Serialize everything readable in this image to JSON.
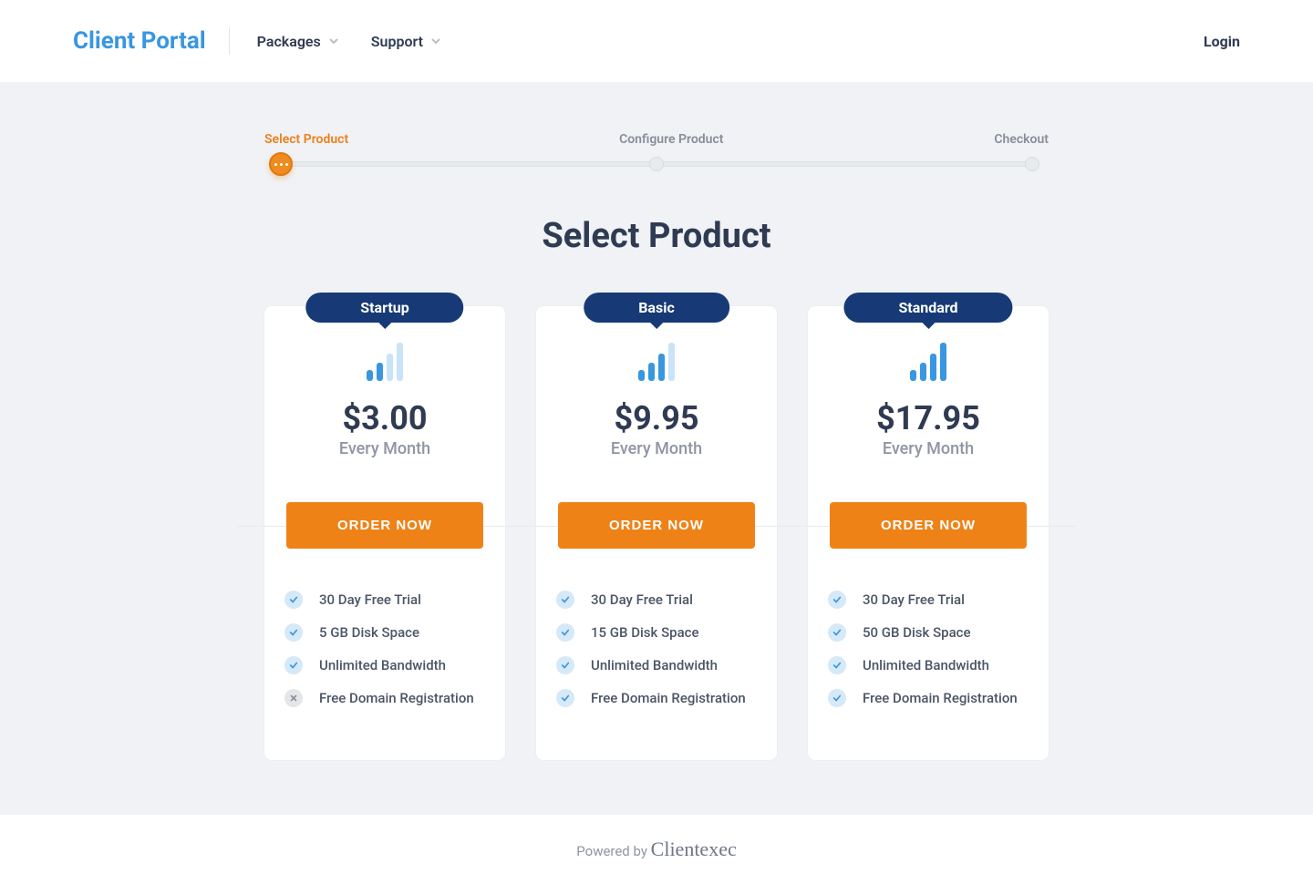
{
  "header": {
    "logo": "Client Portal",
    "nav": [
      {
        "label": "Packages"
      },
      {
        "label": "Support"
      }
    ],
    "login": "Login"
  },
  "progress": {
    "steps": [
      {
        "label": "Select Product",
        "active": true
      },
      {
        "label": "Configure Product",
        "active": false
      },
      {
        "label": "Checkout",
        "active": false
      }
    ]
  },
  "page_title": "Select Product",
  "plans": [
    {
      "name": "Startup",
      "price": "$3.00",
      "period": "Every Month",
      "cta": "ORDER NOW",
      "bars": [
        2
      ],
      "features": [
        {
          "text": "30 Day Free Trial",
          "included": true
        },
        {
          "text": "5 GB Disk Space",
          "included": true
        },
        {
          "text": "Unlimited Bandwidth",
          "included": true
        },
        {
          "text": "Free Domain Registration",
          "included": false
        }
      ]
    },
    {
      "name": "Basic",
      "price": "$9.95",
      "period": "Every Month",
      "cta": "ORDER NOW",
      "bars": [
        3
      ],
      "features": [
        {
          "text": "30 Day Free Trial",
          "included": true
        },
        {
          "text": "15 GB Disk Space",
          "included": true
        },
        {
          "text": "Unlimited Bandwidth",
          "included": true
        },
        {
          "text": "Free Domain Registration",
          "included": true
        }
      ]
    },
    {
      "name": "Standard",
      "price": "$17.95",
      "period": "Every Month",
      "cta": "ORDER NOW",
      "bars": [
        4
      ],
      "features": [
        {
          "text": "30 Day Free Trial",
          "included": true
        },
        {
          "text": "50 GB Disk Space",
          "included": true
        },
        {
          "text": "Unlimited Bandwidth",
          "included": true
        },
        {
          "text": "Free Domain Registration",
          "included": true
        }
      ]
    }
  ],
  "footer": {
    "text": "Powered by ",
    "brand": "Clientexec"
  }
}
